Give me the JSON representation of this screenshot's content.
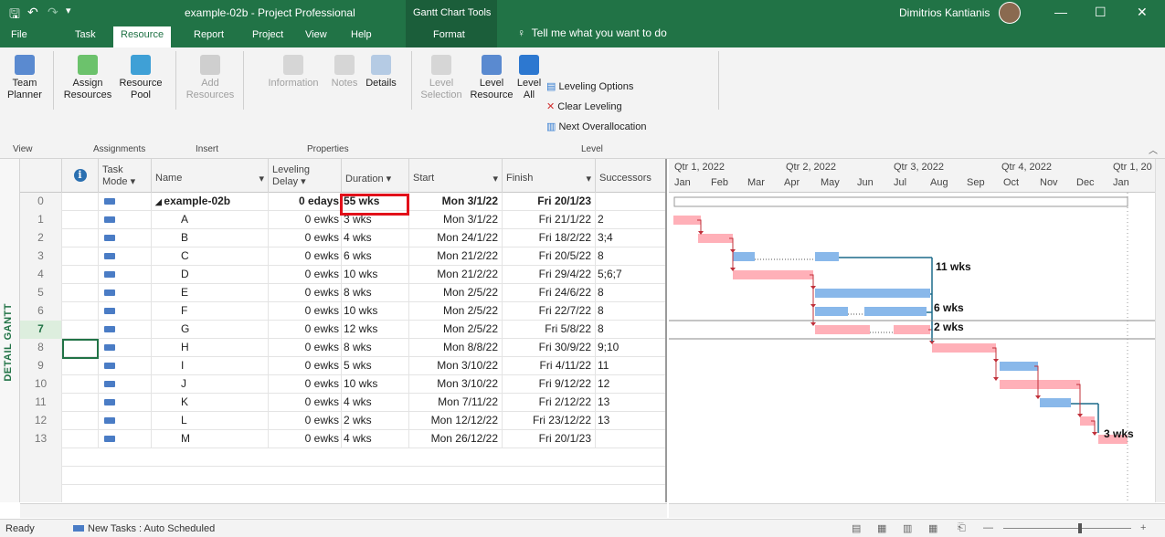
{
  "window": {
    "doc_title": "example-02b  -  Project Professional",
    "tools_label": "Gantt Chart Tools",
    "user_name": "Dimitrios Kantianis",
    "tell_me": "Tell me what you want to do"
  },
  "tabs": [
    "File",
    "Task",
    "Resource",
    "Report",
    "Project",
    "View",
    "Help"
  ],
  "active_tab": "Resource",
  "format_tab": "Format",
  "ribbon": {
    "team_planner": "Team Planner",
    "view_group": "View",
    "assign_resources": "Assign Resources",
    "resource_pool": "Resource Pool",
    "assignments_group": "Assignments",
    "add_resources": "Add Resources",
    "insert_group": "Insert",
    "information": "Information",
    "notes": "Notes",
    "details": "Details",
    "properties_group": "Properties",
    "level_selection": "Level Selection",
    "level_resource": "Level Resource",
    "level_all": "Level All",
    "leveling_options": "Leveling Options",
    "clear_leveling": "Clear Leveling",
    "next_overallocation": "Next Overallocation",
    "level_group": "Level"
  },
  "side_label": "DETAIL GANTT",
  "columns": {
    "task_mode": "Task Mode",
    "name": "Name",
    "leveling_delay": "Leveling Delay",
    "duration": "Duration",
    "start": "Start",
    "finish": "Finish",
    "successors": "Successors"
  },
  "tasks": [
    {
      "id": "0",
      "name": "example-02b",
      "delay": "0 edays",
      "duration": "55 wks",
      "start": "Mon 3/1/22",
      "finish": "Fri 20/1/23",
      "successors": ""
    },
    {
      "id": "1",
      "name": "A",
      "delay": "0 ewks",
      "duration": "3 wks",
      "start": "Mon 3/1/22",
      "finish": "Fri 21/1/22",
      "successors": "2"
    },
    {
      "id": "2",
      "name": "B",
      "delay": "0 ewks",
      "duration": "4 wks",
      "start": "Mon 24/1/22",
      "finish": "Fri 18/2/22",
      "successors": "3;4"
    },
    {
      "id": "3",
      "name": "C",
      "delay": "0 ewks",
      "duration": "6 wks",
      "start": "Mon 21/2/22",
      "finish": "Fri 20/5/22",
      "successors": "8"
    },
    {
      "id": "4",
      "name": "D",
      "delay": "0 ewks",
      "duration": "10 wks",
      "start": "Mon 21/2/22",
      "finish": "Fri 29/4/22",
      "successors": "5;6;7"
    },
    {
      "id": "5",
      "name": "E",
      "delay": "0 ewks",
      "duration": "8 wks",
      "start": "Mon 2/5/22",
      "finish": "Fri 24/6/22",
      "successors": "8"
    },
    {
      "id": "6",
      "name": "F",
      "delay": "0 ewks",
      "duration": "10 wks",
      "start": "Mon 2/5/22",
      "finish": "Fri 22/7/22",
      "successors": "8"
    },
    {
      "id": "7",
      "name": "G",
      "delay": "0 ewks",
      "duration": "12 wks",
      "start": "Mon 2/5/22",
      "finish": "Fri 5/8/22",
      "successors": "8"
    },
    {
      "id": "8",
      "name": "H",
      "delay": "0 ewks",
      "duration": "8 wks",
      "start": "Mon 8/8/22",
      "finish": "Fri 30/9/22",
      "successors": "9;10"
    },
    {
      "id": "9",
      "name": "I",
      "delay": "0 ewks",
      "duration": "5 wks",
      "start": "Mon 3/10/22",
      "finish": "Fri 4/11/22",
      "successors": "11"
    },
    {
      "id": "10",
      "name": "J",
      "delay": "0 ewks",
      "duration": "10 wks",
      "start": "Mon 3/10/22",
      "finish": "Fri 9/12/22",
      "successors": "12"
    },
    {
      "id": "11",
      "name": "K",
      "delay": "0 ewks",
      "duration": "4 wks",
      "start": "Mon 7/11/22",
      "finish": "Fri 2/12/22",
      "successors": "13"
    },
    {
      "id": "12",
      "name": "L",
      "delay": "0 ewks",
      "duration": "2 wks",
      "start": "Mon 12/12/22",
      "finish": "Fri 23/12/22",
      "successors": "13"
    },
    {
      "id": "13",
      "name": "M",
      "delay": "0 ewks",
      "duration": "4 wks",
      "start": "Mon 26/12/22",
      "finish": "Fri 20/1/23",
      "successors": ""
    }
  ],
  "timescale": {
    "quarters": [
      "Qtr 1, 2022",
      "Qtr 2, 2022",
      "Qtr 3, 2022",
      "Qtr 4, 2022",
      "Qtr 1, 20"
    ],
    "months": [
      "Jan",
      "Feb",
      "Mar",
      "Apr",
      "May",
      "Jun",
      "Jul",
      "Aug",
      "Sep",
      "Oct",
      "Nov",
      "Dec",
      "Jan"
    ]
  },
  "gantt_labels": {
    "c_slack": "11 wks",
    "e_slack": "6 wks",
    "f_slack": "2 wks",
    "k_slack": "3 wks"
  },
  "status": {
    "ready": "Ready",
    "new_tasks": "New Tasks : Auto Scheduled"
  },
  "colors": {
    "brand": "#217346",
    "critical": "#ffb0b8",
    "noncritical": "#89b8ea",
    "highlight": "#e2101a"
  }
}
